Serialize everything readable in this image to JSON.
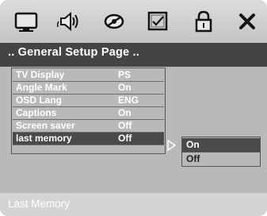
{
  "tabs": [
    {
      "icon": "tv-icon"
    },
    {
      "icon": "speaker-icon"
    },
    {
      "icon": "video-settings-icon"
    },
    {
      "icon": "preferences-icon"
    },
    {
      "icon": "lock-icon"
    },
    {
      "icon": "close-icon"
    }
  ],
  "title": ".. General Setup Page ..",
  "settings": [
    {
      "label": "TV Display",
      "value": "PS"
    },
    {
      "label": "Angle Mark",
      "value": "On"
    },
    {
      "label": "OSD Lang",
      "value": "ENG"
    },
    {
      "label": "Captions",
      "value": "On"
    },
    {
      "label": "Screen saver",
      "value": "Off"
    },
    {
      "label": "last memory",
      "value": "Off"
    }
  ],
  "selected_setting": "last memory",
  "submenu": {
    "options": [
      "On",
      "Off"
    ],
    "highlighted": "On"
  },
  "status": "Last Memory",
  "colors": {
    "panel": "#b9b9b9",
    "header": "#444444",
    "highlight": "#4a4a4a",
    "status_bar": "#d4d4d4"
  }
}
